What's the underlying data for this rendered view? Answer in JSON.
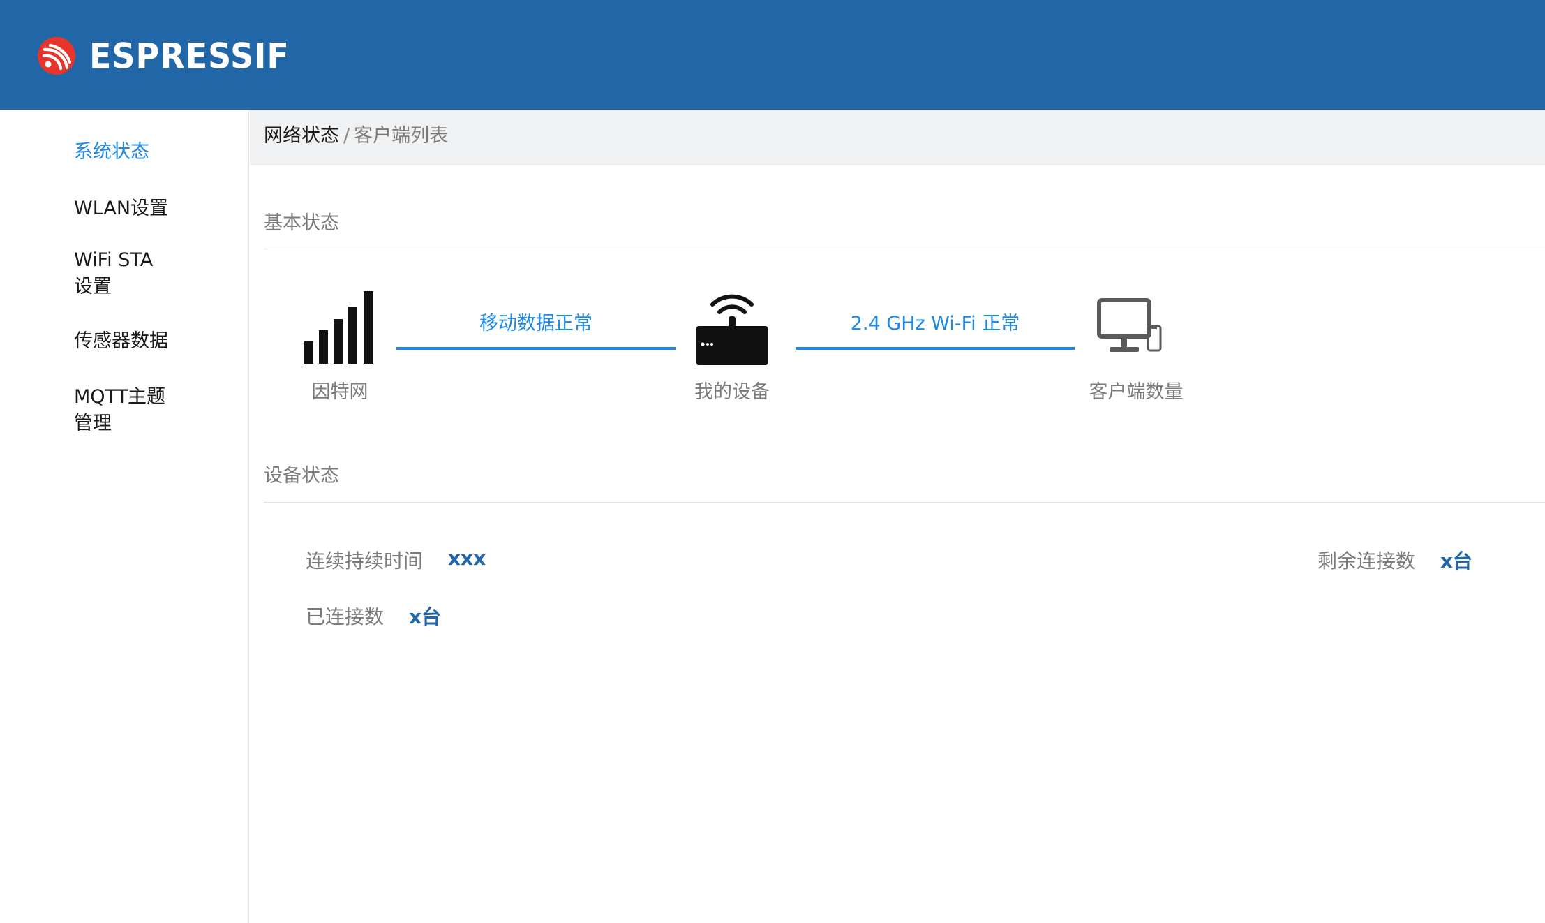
{
  "header": {
    "brand": "ESPRESSIF",
    "logo_icon": "espressif-logo-icon",
    "background_color": "#2167a8"
  },
  "sidebar": {
    "items": [
      {
        "label": "系统状态",
        "active": true
      },
      {
        "label": "WLAN设置",
        "active": false
      },
      {
        "label": "WiFi STA\n设置",
        "active": false
      },
      {
        "label": "传感器数据",
        "active": false
      },
      {
        "label": "MQTT主题\n管理",
        "active": false
      }
    ],
    "active_color": "#1e88e5"
  },
  "breadcrumb": {
    "current": "网络状态",
    "separator": "/",
    "link": "客户端列表"
  },
  "basic_status": {
    "title": "基本状态",
    "nodes": [
      {
        "label": "因特网",
        "icon": "signal-bars-icon"
      },
      {
        "label": "我的设备",
        "icon": "router-icon"
      },
      {
        "label": "客户端数量",
        "icon": "monitor-phone-icon"
      }
    ],
    "links": [
      {
        "label": "移动数据正常"
      },
      {
        "label": "2.4 GHz Wi-Fi 正常"
      }
    ],
    "link_color": "#1e88e5"
  },
  "device_status": {
    "title": "设备状态",
    "uptime_label": "连续持续时间",
    "uptime_value": "xxx",
    "remaining_label": "剩余连接数",
    "remaining_value": "x台",
    "connected_label": "已连接数",
    "connected_value": "x台",
    "value_color": "#2167a8"
  }
}
